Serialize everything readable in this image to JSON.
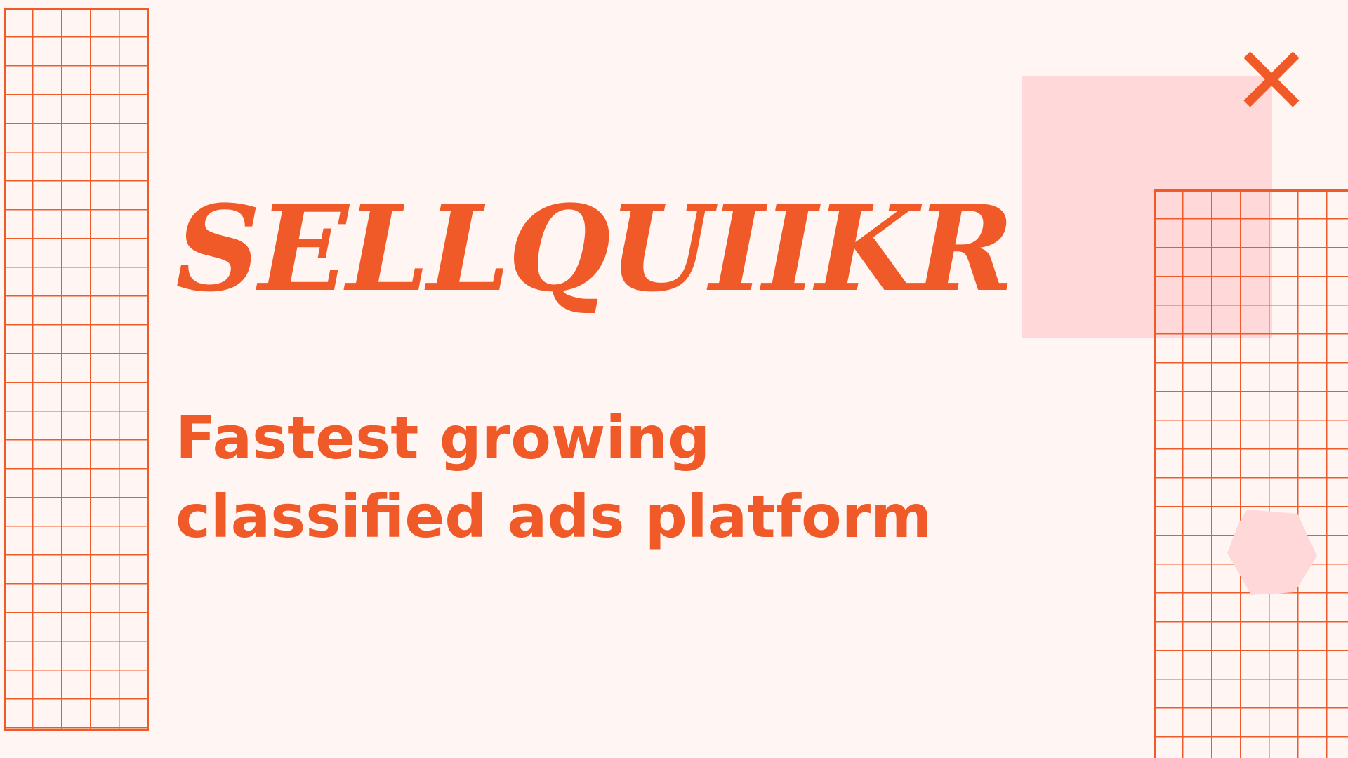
{
  "brand": {
    "name": "SELLQUIIKR"
  },
  "tagline": {
    "line1": "Fastest growing",
    "line2": "classified ads platform"
  },
  "icons": {
    "close": "close-icon"
  },
  "colors": {
    "background": "#FFF6F4",
    "accent": "#F05A28",
    "soft_pink": "#FFD9D9"
  }
}
